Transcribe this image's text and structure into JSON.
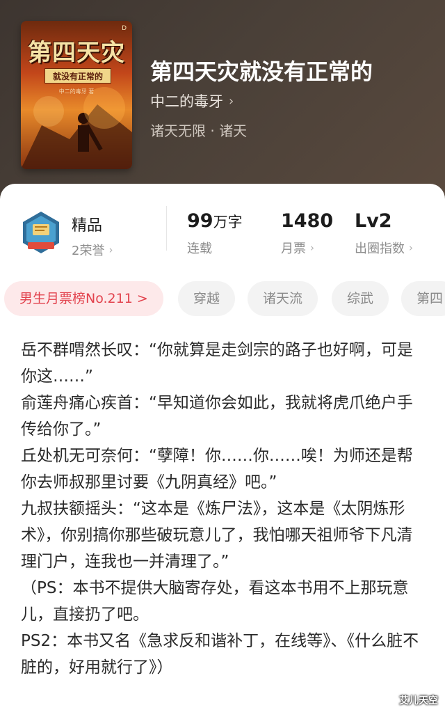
{
  "book": {
    "title": "第四天灾就没有正常的",
    "author": "中二的毒牙",
    "genre": "诸天无限 · 诸天",
    "cover": {
      "title": "第四天灾",
      "subtitle": "就没有正常的",
      "author": "中二的毒牙 著"
    }
  },
  "stats": {
    "quality": {
      "value": "精品",
      "label": "2荣誉"
    },
    "words": {
      "value": "99",
      "unit": "万字",
      "label": "连载"
    },
    "tickets": {
      "value": "1480",
      "label": "月票"
    },
    "level": {
      "value": "Lv2",
      "label": "出圈指数"
    }
  },
  "tags": [
    "男生月票榜No.211 >",
    "穿越",
    "诸天流",
    "综武",
    "第四"
  ],
  "intro": [
    "岳不群喟然长叹：“你就算是走剑宗的路子也好啊，可是你这……”",
    "俞莲舟痛心疾首：“早知道你会如此，我就将虎爪绝户手传给你了。”",
    "丘处机无可奈何：“孽障！你……你……唉！为师还是帮你去师叔那里讨要《九阴真经》吧。”",
    "九叔扶额摇头：“这本是《炼尸法》，这本是《太阴炼形术》，你别搞你那些破玩意儿了，我怕哪天祖师爷下凡清理门户，连我也一并清理了。”",
    "（PS：本书不提供大脑寄存处，看这本书用不上那玩意儿，直接扔了吧。",
    "PS2：本书又名《急求反和谐补丁，在线等》、《什么脏不脏的，好用就行了》）"
  ],
  "watermark": "艾儿天空",
  "colors": {
    "rank_tag_text": "#e2424d",
    "rank_tag_bg": "#fde9ea"
  }
}
